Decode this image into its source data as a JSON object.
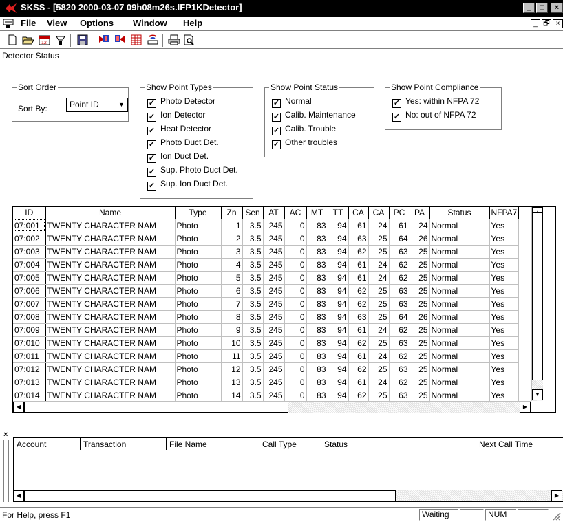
{
  "window": {
    "title": "SKSS - [5820 2000-03-07 09h08m26s.IFP1KDetector]",
    "controls": [
      "_",
      "□",
      "×"
    ],
    "mdi_controls": [
      "_",
      "🗗",
      "×"
    ]
  },
  "menu": [
    {
      "label": "File"
    },
    {
      "label": "View"
    },
    {
      "label": "Options"
    },
    {
      "label": "Window"
    },
    {
      "label": "Help"
    }
  ],
  "toolbar": {
    "icons": [
      "new-file-icon",
      "open-folder-icon",
      "calendar-icon",
      "disconnect-icon",
      "save-icon",
      "red-flag-upload-icon",
      "blue-flag-download-icon",
      "grid-red-icon",
      "modem-icon",
      "print-icon",
      "print-preview-icon"
    ]
  },
  "panel": {
    "label": "Detector Status",
    "sort_order": {
      "title": "Sort Order",
      "sort_by_label": "Sort By:",
      "sort_by_value": "Point ID"
    },
    "point_types": {
      "title": "Show Point Types",
      "items": [
        {
          "label": "Photo Detector",
          "checked": true
        },
        {
          "label": "Ion Detector",
          "checked": true
        },
        {
          "label": "Heat Detector",
          "checked": true
        },
        {
          "label": "Photo Duct Det.",
          "checked": true
        },
        {
          "label": "Ion Duct Det.",
          "checked": true
        },
        {
          "label": "Sup. Photo Duct Det.",
          "checked": true
        },
        {
          "label": "Sup. Ion Duct Det.",
          "checked": true
        }
      ]
    },
    "point_status": {
      "title": "Show Point Status",
      "items": [
        {
          "label": "Normal",
          "checked": true
        },
        {
          "label": "Calib. Maintenance",
          "checked": true
        },
        {
          "label": "Calib. Trouble",
          "checked": true
        },
        {
          "label": "Other troubles",
          "checked": true
        }
      ]
    },
    "point_compliance": {
      "title": "Show Point Compliance",
      "items": [
        {
          "label": "Yes: within NFPA 72",
          "checked": true
        },
        {
          "label": "No: out of NFPA 72",
          "checked": true
        }
      ]
    }
  },
  "table": {
    "columns": [
      "ID",
      "Name",
      "Type",
      "Zn",
      "Sen",
      "AT",
      "AC",
      "MT",
      "TT",
      "CA",
      "CA",
      "PC",
      "PA",
      "Status",
      "NFPA7"
    ],
    "rows": [
      [
        "07:001",
        "TWENTY CHARACTER NAM",
        "Photo",
        "1",
        "3.5",
        "245",
        "0",
        "83",
        "94",
        "61",
        "24",
        "61",
        "24",
        "Normal",
        "Yes"
      ],
      [
        "07:002",
        "TWENTY CHARACTER NAM",
        "Photo",
        "2",
        "3.5",
        "245",
        "0",
        "83",
        "94",
        "63",
        "25",
        "64",
        "26",
        "Normal",
        "Yes"
      ],
      [
        "07:003",
        "TWENTY CHARACTER NAM",
        "Photo",
        "3",
        "3.5",
        "245",
        "0",
        "83",
        "94",
        "62",
        "25",
        "63",
        "25",
        "Normal",
        "Yes"
      ],
      [
        "07:004",
        "TWENTY CHARACTER NAM",
        "Photo",
        "4",
        "3.5",
        "245",
        "0",
        "83",
        "94",
        "61",
        "24",
        "62",
        "25",
        "Normal",
        "Yes"
      ],
      [
        "07:005",
        "TWENTY CHARACTER NAM",
        "Photo",
        "5",
        "3.5",
        "245",
        "0",
        "83",
        "94",
        "61",
        "24",
        "62",
        "25",
        "Normal",
        "Yes"
      ],
      [
        "07:006",
        "TWENTY CHARACTER NAM",
        "Photo",
        "6",
        "3.5",
        "245",
        "0",
        "83",
        "94",
        "62",
        "25",
        "63",
        "25",
        "Normal",
        "Yes"
      ],
      [
        "07:007",
        "TWENTY CHARACTER NAM",
        "Photo",
        "7",
        "3.5",
        "245",
        "0",
        "83",
        "94",
        "62",
        "25",
        "63",
        "25",
        "Normal",
        "Yes"
      ],
      [
        "07:008",
        "TWENTY CHARACTER NAM",
        "Photo",
        "8",
        "3.5",
        "245",
        "0",
        "83",
        "94",
        "63",
        "25",
        "64",
        "26",
        "Normal",
        "Yes"
      ],
      [
        "07:009",
        "TWENTY CHARACTER NAM",
        "Photo",
        "9",
        "3.5",
        "245",
        "0",
        "83",
        "94",
        "61",
        "24",
        "62",
        "25",
        "Normal",
        "Yes"
      ],
      [
        "07:010",
        "TWENTY CHARACTER NAM",
        "Photo",
        "10",
        "3.5",
        "245",
        "0",
        "83",
        "94",
        "62",
        "25",
        "63",
        "25",
        "Normal",
        "Yes"
      ],
      [
        "07:011",
        "TWENTY CHARACTER NAM",
        "Photo",
        "11",
        "3.5",
        "245",
        "0",
        "83",
        "94",
        "61",
        "24",
        "62",
        "25",
        "Normal",
        "Yes"
      ],
      [
        "07:012",
        "TWENTY CHARACTER NAM",
        "Photo",
        "12",
        "3.5",
        "245",
        "0",
        "83",
        "94",
        "62",
        "25",
        "63",
        "25",
        "Normal",
        "Yes"
      ],
      [
        "07:013",
        "TWENTY CHARACTER NAM",
        "Photo",
        "13",
        "3.5",
        "245",
        "0",
        "83",
        "94",
        "61",
        "24",
        "62",
        "25",
        "Normal",
        "Yes"
      ],
      [
        "07:014",
        "TWENTY CHARACTER NAM",
        "Photo",
        "14",
        "3.5",
        "245",
        "0",
        "83",
        "94",
        "62",
        "25",
        "63",
        "25",
        "Normal",
        "Yes"
      ]
    ]
  },
  "bottom": {
    "columns": [
      "Account",
      "Transaction",
      "File Name",
      "Call Type",
      "Status",
      "Next Call Time"
    ]
  },
  "status": {
    "help": "For Help, press F1",
    "state": "Waiting",
    "num": "NUM"
  },
  "colors": {
    "titlebar_bg": "#000000",
    "logo_red": "#e02020"
  }
}
